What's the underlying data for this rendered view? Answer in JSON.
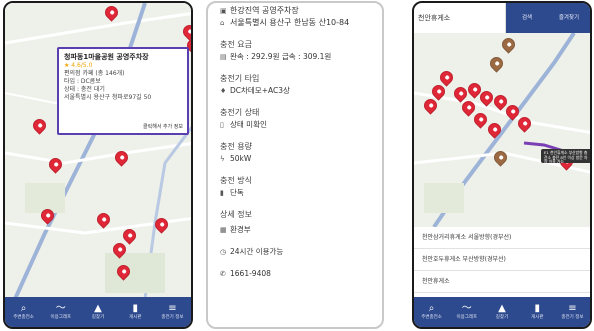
{
  "colors": {
    "nav_bg": "#2e4a8e",
    "pin_red": "#e02737",
    "pin_brown": "#9b6a43",
    "popup_border": "#5a3fb0"
  },
  "nav": [
    {
      "icon": "search-icon",
      "glyph": "⌕",
      "label": "주변충전소"
    },
    {
      "icon": "trend-icon",
      "glyph": "〜",
      "label": "이용그래프"
    },
    {
      "icon": "navigate-icon",
      "glyph": "▲",
      "label": "길찾기"
    },
    {
      "icon": "book-icon",
      "glyph": "▮",
      "label": "게시판"
    },
    {
      "icon": "menu-icon",
      "glyph": "≡",
      "label": "충전기 정보"
    }
  ],
  "screen1": {
    "popup": {
      "title": "청파동1마을공원 공영주차장",
      "rating": "★ 4.6/5.0",
      "nearby": "편의점 카페 (총 146개)",
      "type": "타입 : DC콤보",
      "status": "상태 : 충전 대기",
      "address": "서울특별시 용산구 청파로97길 50",
      "footer": "클릭해서 추가 정보"
    }
  },
  "screen2": {
    "title": "한강진역 공영주차장",
    "address": "서울특별시 용산구 한남동 산10-84",
    "fee_heading": "충전 요금",
    "fee_value": "완속 : 292.9원  급속 : 309.1원",
    "type_heading": "충전기 타입",
    "type_value": "DC차데모+AC3상",
    "status_heading": "충전기 상태",
    "status_value": "상태 미확인",
    "capacity_heading": "충전 용량",
    "capacity_value": "50kW",
    "method_heading": "충전 방식",
    "method_value": "단독",
    "more_heading": "상세 정보",
    "operator": "환경부",
    "hours": "24시간 이용가능",
    "phone": "1661-9408"
  },
  "screen3": {
    "search_value": "천안휴게소",
    "tabs": [
      "검색",
      "즐겨찾기"
    ],
    "tooltip": "E1 천안휴게소 부산방향 충전소 충전 8인 이상 방문 차량 이용 가능",
    "results": [
      "천안삼거리휴게소 서울방향(경부선)",
      "천안호두휴게소 부산방향(경부선)",
      "천안휴게소"
    ]
  }
}
